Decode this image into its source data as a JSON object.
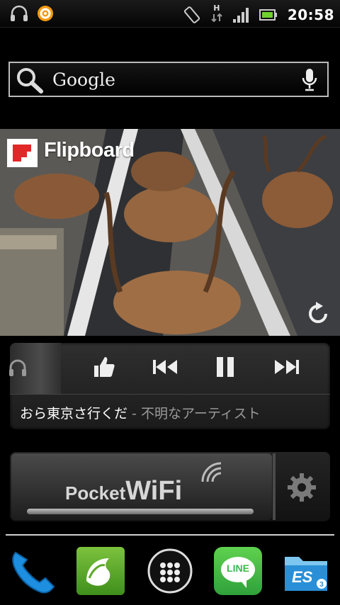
{
  "status_bar": {
    "time": "20:58",
    "network_type": "H",
    "icons": [
      "headphones-icon",
      "app-notification-icon",
      "rotation-icon",
      "data-arrows-icon",
      "signal-icon",
      "battery-icon"
    ]
  },
  "search": {
    "label": "Google",
    "icons": [
      "search-icon",
      "microphone-icon"
    ]
  },
  "flipboard": {
    "title": "Flipboard",
    "icons": [
      "flipboard-logo",
      "refresh-icon"
    ]
  },
  "music": {
    "song_title": "おら東京さ行くだ",
    "separator": " - ",
    "artist": "不明なアーティスト",
    "controls": [
      "like-icon",
      "previous-icon",
      "pause-icon",
      "next-icon"
    ]
  },
  "wifi_widget": {
    "logo_prefix": "Pocket",
    "logo_suffix": "WiFi",
    "icons": [
      "gear-icon"
    ]
  },
  "dock": {
    "apps": [
      "phone-icon",
      "dolphin-browser-icon",
      "app-drawer-icon",
      "line-icon",
      "es-file-explorer-icon"
    ],
    "line_label": "LINE",
    "es_label": "ES"
  },
  "colors": {
    "line_green": "#3cb84a",
    "dolphin_green": "#5ea92c",
    "phone_blue": "#1e8fe0",
    "es_blue": "#2a8fd6"
  }
}
